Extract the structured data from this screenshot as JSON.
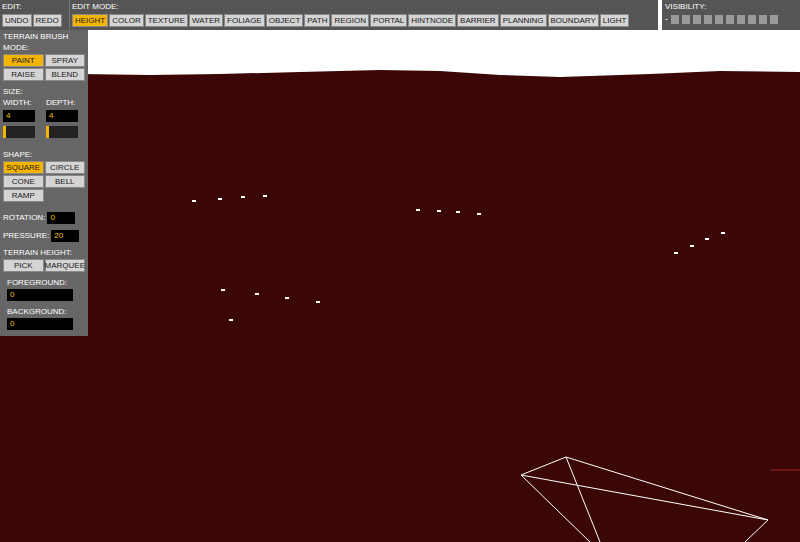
{
  "toolbar": {
    "edit": {
      "label": "EDIT:",
      "buttons": [
        {
          "label": "UNDO"
        },
        {
          "label": "REDO"
        }
      ]
    },
    "edit_mode": {
      "label": "EDIT MODE:",
      "modes": [
        {
          "label": "HEIGHT",
          "selected": true
        },
        {
          "label": "COLOR",
          "selected": false
        },
        {
          "label": "TEXTURE",
          "selected": false
        },
        {
          "label": "WATER",
          "selected": false
        },
        {
          "label": "FOLIAGE",
          "selected": false
        },
        {
          "label": "OBJECT",
          "selected": false
        },
        {
          "label": "PATH",
          "selected": false
        },
        {
          "label": "REGION",
          "selected": false
        },
        {
          "label": "PORTAL",
          "selected": false
        },
        {
          "label": "HINTNODE",
          "selected": false
        },
        {
          "label": "BARRIER",
          "selected": false
        },
        {
          "label": "PLANNING",
          "selected": false
        },
        {
          "label": "BOUNDARY",
          "selected": false
        },
        {
          "label": "LIGHT",
          "selected": false
        }
      ]
    },
    "visibility": {
      "label": "VISIBILITY:",
      "minus": "-",
      "toggles": [
        {
          "on": true
        },
        {
          "on": true
        },
        {
          "on": true
        },
        {
          "on": true
        },
        {
          "on": true
        },
        {
          "on": true
        },
        {
          "on": true
        },
        {
          "on": true
        },
        {
          "on": true
        },
        {
          "on": true
        }
      ]
    }
  },
  "brush_panel": {
    "title": "TERRAIN BRUSH",
    "mode_label": "MODE:",
    "modes": [
      {
        "label": "PAINT",
        "selected": true
      },
      {
        "label": "SPRAY",
        "selected": false
      },
      {
        "label": "RAISE",
        "selected": false
      },
      {
        "label": "BLEND",
        "selected": false
      }
    ],
    "size_label": "SIZE:",
    "size_fields": [
      {
        "label": "WIDTH:",
        "value": "4",
        "level": 0.1
      },
      {
        "label": "DEPTH:",
        "value": "4",
        "level": 0.1
      }
    ],
    "shape_label": "SHAPE:",
    "shapes": [
      {
        "label": "SQUARE",
        "selected": true
      },
      {
        "label": "CIRCLE",
        "selected": false
      },
      {
        "label": "CONE",
        "selected": false
      },
      {
        "label": "BELL",
        "selected": false
      },
      {
        "label": "RAMP",
        "selected": false
      }
    ],
    "rotation": {
      "label": "ROTATION:",
      "value": "0"
    },
    "pressure": {
      "label": "PRESSURE:",
      "value": "20"
    },
    "terrain_height": {
      "label": "TERRAIN HEIGHT:",
      "buttons": [
        {
          "label": "PICK"
        },
        {
          "label": "MARQUEE"
        }
      ]
    },
    "foreground": {
      "label": "FOREGROUND:",
      "value": "0"
    },
    "background": {
      "label": "BACKGROUND:",
      "value": "0"
    }
  }
}
